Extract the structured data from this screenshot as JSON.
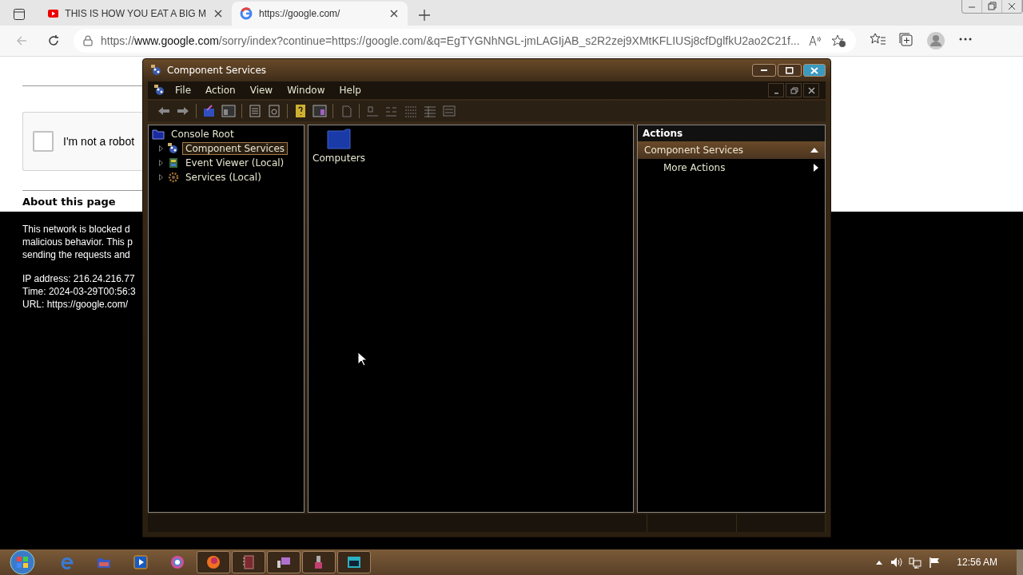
{
  "browser": {
    "tabs": [
      {
        "title": "THIS IS HOW YOU EAT A BIG M",
        "kind": "video",
        "selected": false
      },
      {
        "title": "https://google.com/",
        "kind": "google",
        "selected": true
      }
    ],
    "address": {
      "scheme": "https://",
      "host": "www.google.com",
      "path": "/sorry/index?continue=https://google.com/&q=EgTYGNhNGL-jmLAGIjAB_s2R2zej9XMtKFLIUSj8cfDglfkU2ao2C21f..."
    }
  },
  "page": {
    "captcha": {
      "label": "I'm not a robot",
      "checked": false
    },
    "heading": "About this page",
    "paragraph": [
      "This network is blocked d",
      "malicious behavior. This p",
      "sending the requests and"
    ],
    "details": [
      "IP address: 216.24.216.77",
      "Time: 2024-03-29T00:56:3",
      "URL: https://google.com/"
    ]
  },
  "window": {
    "title": "Component Services",
    "menu": [
      "File",
      "Action",
      "View",
      "Window",
      "Help"
    ],
    "tree": {
      "label": "Console Root",
      "children": [
        {
          "label": "Component Services",
          "kind": "component",
          "selected": true,
          "expanded": false
        },
        {
          "label": "Event Viewer (Local)",
          "kind": "events",
          "selected": false,
          "expanded": false
        },
        {
          "label": "Services (Local)",
          "kind": "gear",
          "selected": false,
          "expanded": false
        }
      ]
    },
    "items": [
      {
        "label": "Computers"
      }
    ],
    "actions": {
      "title": "Actions",
      "sections": [
        {
          "label": "Component Services",
          "expanded": true,
          "items": [
            {
              "label": "More Actions"
            }
          ]
        }
      ]
    }
  },
  "taskbar": {
    "apps": [
      {
        "kind": "ie",
        "running": false
      },
      {
        "kind": "folder",
        "running": false
      },
      {
        "kind": "media",
        "running": false
      },
      {
        "kind": "chrome",
        "running": false
      },
      {
        "kind": "edge",
        "running": true
      },
      {
        "kind": "notepad",
        "running": true
      },
      {
        "kind": "display",
        "running": true
      },
      {
        "kind": "tool",
        "running": true
      },
      {
        "kind": "console",
        "running": true
      }
    ],
    "clock": "12:56 AM"
  }
}
